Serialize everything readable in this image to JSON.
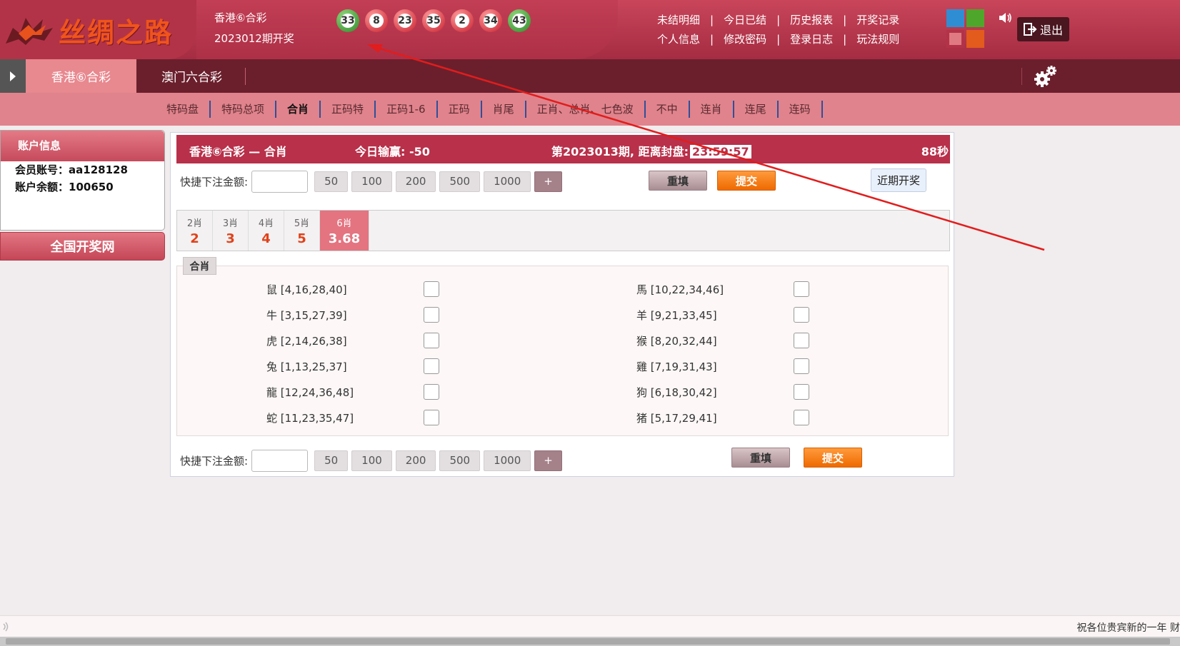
{
  "header": {
    "logo_text": "丝绸之路",
    "lottery_name": "香港⑥合彩",
    "lottery_period": "2023012期开奖",
    "balls": [
      {
        "num": "33",
        "color": "green"
      },
      {
        "num": "8",
        "color": "red"
      },
      {
        "num": "23",
        "color": "red"
      },
      {
        "num": "35",
        "color": "red"
      },
      {
        "num": "2",
        "color": "red"
      },
      {
        "num": "34",
        "color": "red"
      },
      {
        "num": "43",
        "color": "green"
      }
    ],
    "links_row1": [
      "未结明细",
      "今日已结",
      "历史报表",
      "开奖记录"
    ],
    "links_row2": [
      "个人信息",
      "修改密码",
      "登录日志",
      "玩法规则"
    ],
    "separator": "|",
    "swatch_colors": [
      "#2f8ed3",
      "#4ea62a",
      "#e07a82",
      "#e35b1d"
    ],
    "logout_label": "退出"
  },
  "tabs": {
    "active": "香港⑥合彩",
    "inactive": "澳门六合彩"
  },
  "subnav": [
    "特码盘",
    "特码总项",
    "合肖",
    "正码特",
    "正码1-6",
    "正码",
    "肖尾",
    "正肖、总肖、七色波",
    "不中",
    "连肖",
    "连尾",
    "连码"
  ],
  "subnav_active_index": 2,
  "account": {
    "title": "账户信息",
    "member_label": "会员账号：",
    "member_value": "aa128128",
    "balance_label": "账户余额：",
    "balance_value": "100650",
    "link_label": "全国开奖网"
  },
  "main": {
    "head_title": "香港⑥合彩 — 合肖",
    "head_winloss": "今日输赢: -50",
    "head_period": "第2023013期, 距离封盘:",
    "head_countdown": "23:59:57",
    "head_seconds": "88秒",
    "quick_label": "快捷下注金额:",
    "amounts": [
      "50",
      "100",
      "200",
      "500",
      "1000"
    ],
    "plus_label": "+",
    "reset_label": "重填",
    "submit_label": "提交",
    "recent_label": "近期开奖",
    "odds_tabs": [
      {
        "name": "2肖",
        "value": "2"
      },
      {
        "name": "3肖",
        "value": "3"
      },
      {
        "name": "4肖",
        "value": "4"
      },
      {
        "name": "5肖",
        "value": "5"
      },
      {
        "name": "6肖",
        "value": "3.68"
      }
    ],
    "odds_active_index": 4,
    "group_label": "合肖",
    "zodiac_left": [
      "鼠 [4,16,28,40]",
      "牛 [3,15,27,39]",
      "虎 [2,14,26,38]",
      "兔 [1,13,25,37]",
      "龍 [12,24,36,48]",
      "蛇 [11,23,35,47]"
    ],
    "zodiac_right": [
      "馬 [10,22,34,46]",
      "羊 [9,21,33,45]",
      "猴 [8,20,32,44]",
      "雞 [7,19,31,43]",
      "狗 [6,18,30,42]",
      "猪 [5,17,29,41]"
    ]
  },
  "footer": {
    "marquee_text": "祝各位贵宾新的一年 财"
  }
}
